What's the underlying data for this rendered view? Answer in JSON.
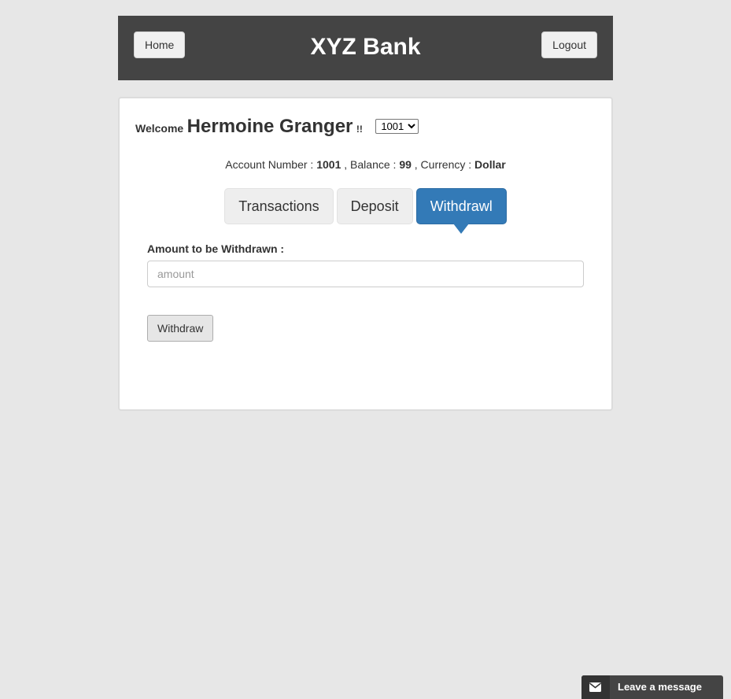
{
  "header": {
    "title": "XYZ Bank",
    "home_label": "Home",
    "logout_label": "Logout"
  },
  "customer": {
    "welcome_label": "Welcome",
    "name": "Hermoine Granger",
    "suffix": "!!",
    "selected_account": "1001"
  },
  "account_info": {
    "account_number_label": "Account Number :",
    "account_number": "1001",
    "balance_label": ", Balance :",
    "balance": "99",
    "currency_label": ", Currency :",
    "currency": "Dollar"
  },
  "tabs": [
    {
      "label": "Transactions",
      "active": false
    },
    {
      "label": "Deposit",
      "active": false
    },
    {
      "label": "Withdrawl",
      "active": true
    }
  ],
  "withdraw_form": {
    "amount_label": "Amount to be Withdrawn :",
    "amount_placeholder": "amount",
    "amount_value": "",
    "submit_label": "Withdraw"
  },
  "chat": {
    "label": "Leave a message",
    "icon": "envelope-icon"
  },
  "colors": {
    "page_background": "#e7e7e7",
    "header_background": "#444444",
    "active_tab": "#337ab7",
    "chat_background": "#444444"
  }
}
